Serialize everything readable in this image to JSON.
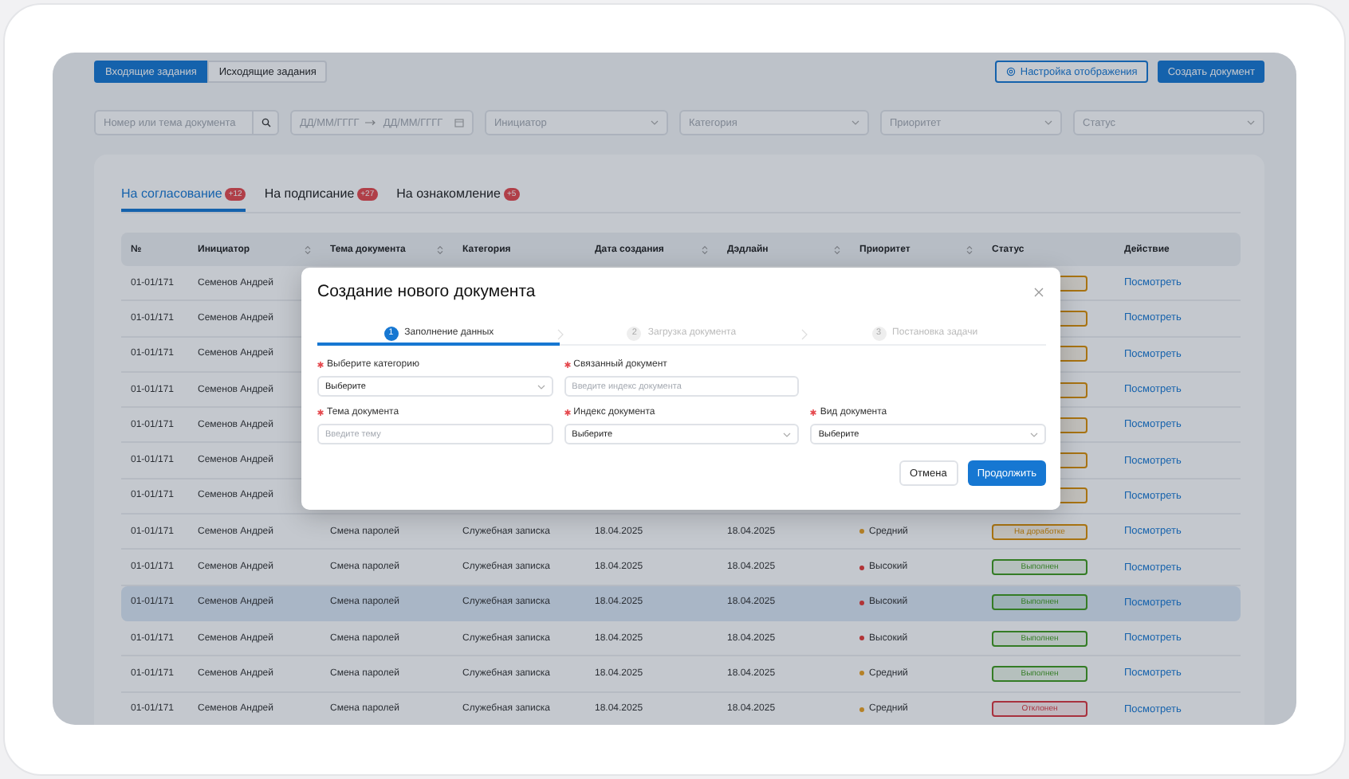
{
  "view_switch": [
    {
      "label": "Входящие задания",
      "selected": true
    },
    {
      "label": "Исходящие задания",
      "selected": false
    }
  ],
  "toolbar": {
    "settings_button": "Настройка отображения",
    "create_button": "Создать документ"
  },
  "filters": [
    {
      "kind": "search",
      "placeholder": "Номер или тема документа"
    },
    {
      "kind": "daterange",
      "from_placeholder": "ДД/ММ/ГГГГ",
      "to_placeholder": "ДД/ММ/ГГГГ"
    },
    {
      "kind": "select",
      "placeholder": "Инициатор"
    },
    {
      "kind": "select",
      "placeholder": "Категория"
    },
    {
      "kind": "select",
      "placeholder": "Приоритет"
    },
    {
      "kind": "select",
      "placeholder": "Статус"
    }
  ],
  "tabs": [
    {
      "label": "На согласование",
      "badge": "+12",
      "selected": true
    },
    {
      "label": "На подписание",
      "badge": "+27",
      "selected": false
    },
    {
      "label": "На ознакомление",
      "badge": "+5",
      "selected": false
    }
  ],
  "table": {
    "columns": [
      {
        "label": "№",
        "sortable": false
      },
      {
        "label": "Инициатор",
        "sortable": true
      },
      {
        "label": "Тема документа",
        "sortable": true
      },
      {
        "label": "Категория",
        "sortable": false
      },
      {
        "label": "Дата создания",
        "sortable": true
      },
      {
        "label": "Дэдлайн",
        "sortable": true
      },
      {
        "label": "Приоритет",
        "sortable": true
      },
      {
        "label": "Статус",
        "sortable": false
      },
      {
        "label": "Действие",
        "sortable": false
      }
    ],
    "rows": [
      {
        "number": "01-01/171",
        "initiator": "Семенов Андрей",
        "status": {
          "color": "#a87312"
        },
        "action": "Посмотреть",
        "selected": false
      },
      {
        "number": "01-01/171",
        "initiator": "Семенов Андрей",
        "status": {
          "color": "#a87312"
        },
        "action": "Посмотреть",
        "selected": false
      },
      {
        "number": "01-01/171",
        "initiator": "Семенов Андрей",
        "status": {
          "color": "#a87312"
        },
        "action": "Посмотреть",
        "selected": false
      },
      {
        "number": "01-01/171",
        "initiator": "Семенов Андрей",
        "status": {
          "color": "#a87312"
        },
        "action": "Посмотреть",
        "selected": false
      },
      {
        "number": "01-01/171",
        "initiator": "Семенов Андрей",
        "status": {
          "color": "#a87312"
        },
        "action": "Посмотреть",
        "selected": false
      },
      {
        "number": "01-01/171",
        "initiator": "Семенов Андрей",
        "status": {
          "color": "#a87312"
        },
        "action": "Посмотреть",
        "selected": false
      },
      {
        "number": "01-01/171",
        "initiator": "Семенов Андрей",
        "status": {
          "color": "#a87312"
        },
        "action": "Посмотреть",
        "selected": false
      },
      {
        "number": "01-01/171",
        "initiator": "Семенов Андрей",
        "topic": "Смена паролей",
        "category": "Служебная записка",
        "created": "18.04.2025",
        "deadline": "18.04.2025",
        "priority": {
          "label": "Средний",
          "color": "#b58127"
        },
        "status": {
          "label": "На доработке",
          "color": "#a87312"
        },
        "action": "Посмотреть",
        "selected": false
      },
      {
        "number": "01-01/171",
        "initiator": "Семенов Андрей",
        "topic": "Смена паролей",
        "category": "Служебная записка",
        "created": "18.04.2025",
        "deadline": "18.04.2025",
        "priority": {
          "label": "Высокий",
          "color": "#b13437"
        },
        "status": {
          "label": "Выполнен",
          "color": "#347c25"
        },
        "action": "Посмотреть",
        "selected": false
      },
      {
        "number": "01-01/171",
        "initiator": "Семенов Андрей",
        "topic": "Смена паролей",
        "category": "Служебная записка",
        "created": "18.04.2025",
        "deadline": "18.04.2025",
        "priority": {
          "label": "Высокий",
          "color": "#b13437"
        },
        "status": {
          "label": "Выполнен",
          "color": "#347c25"
        },
        "action": "Посмотреть",
        "selected": true
      },
      {
        "number": "01-01/171",
        "initiator": "Семенов Андрей",
        "topic": "Смена паролей",
        "category": "Служебная записка",
        "created": "18.04.2025",
        "deadline": "18.04.2025",
        "priority": {
          "label": "Высокий",
          "color": "#b13437"
        },
        "status": {
          "label": "Выполнен",
          "color": "#347c25"
        },
        "action": "Посмотреть",
        "selected": false
      },
      {
        "number": "01-01/171",
        "initiator": "Семенов Андрей",
        "topic": "Смена паролей",
        "category": "Служебная записка",
        "created": "18.04.2025",
        "deadline": "18.04.2025",
        "priority": {
          "label": "Средний",
          "color": "#b58127"
        },
        "status": {
          "label": "Выполнен",
          "color": "#347c25"
        },
        "action": "Посмотреть",
        "selected": false
      },
      {
        "number": "01-01/171",
        "initiator": "Семенов Андрей",
        "topic": "Смена паролей",
        "category": "Служебная записка",
        "created": "18.04.2025",
        "deadline": "18.04.2025",
        "priority": {
          "label": "Средний",
          "color": "#b58127"
        },
        "status": {
          "label": "Отклонен",
          "color": "#a8313e"
        },
        "action": "Посмотреть",
        "selected": false
      }
    ]
  },
  "modal": {
    "title": "Создание нового документа",
    "steps": [
      {
        "number": "1",
        "label": "Заполнение данных",
        "selected": true
      },
      {
        "number": "2",
        "label": "Загрузка документа",
        "selected": false
      },
      {
        "number": "3",
        "label": "Постановка задачи",
        "selected": false
      }
    ],
    "field_rows": [
      [
        {
          "kind": "select",
          "label": "Выберите категорию",
          "required": true,
          "value": "Выберите"
        },
        {
          "kind": "input",
          "label": "Связанный документ",
          "required": true,
          "placeholder": "Введите индекс документа"
        }
      ],
      [
        {
          "kind": "input",
          "label": "Тема документа",
          "required": true,
          "placeholder": "Введите тему"
        },
        {
          "kind": "select",
          "label": "Индекс документа",
          "required": true,
          "value": "Выберите"
        },
        {
          "kind": "select",
          "label": "Вид документа",
          "required": true,
          "value": "Выберите"
        }
      ]
    ],
    "cancel_button": "Отмена",
    "continue_button": "Продолжить"
  }
}
